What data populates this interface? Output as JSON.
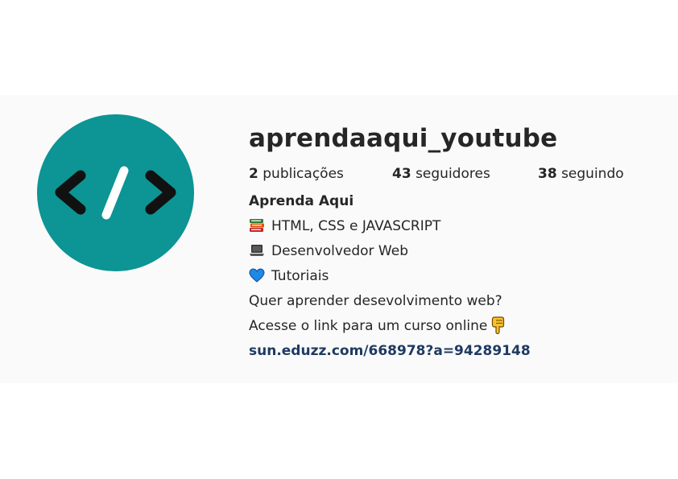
{
  "profile": {
    "username": "aprendaaqui_youtube",
    "avatar_icon": "code-brackets-icon",
    "avatar_color": "#0d9494"
  },
  "stats": {
    "posts_count": "2",
    "posts_label": "publicações",
    "followers_count": "43",
    "followers_label": "seguidores",
    "following_count": "38",
    "following_label": "seguindo"
  },
  "bio": {
    "name": "Aprenda Aqui",
    "line1_icon": "books-icon",
    "line1": "HTML, CSS e JAVASCRIPT",
    "line2_icon": "laptop-icon",
    "line2": "Desenvolvedor Web",
    "line3_icon": "blue-heart-icon",
    "line3": "Tutoriais",
    "line4": "Quer aprender desevolvimento web?",
    "line5": "Acesse o link para um curso online",
    "line5_icon": "pointing-down-icon",
    "link": "sun.eduzz.com/668978?a=94289148",
    "link_color": "#1f3a61"
  }
}
